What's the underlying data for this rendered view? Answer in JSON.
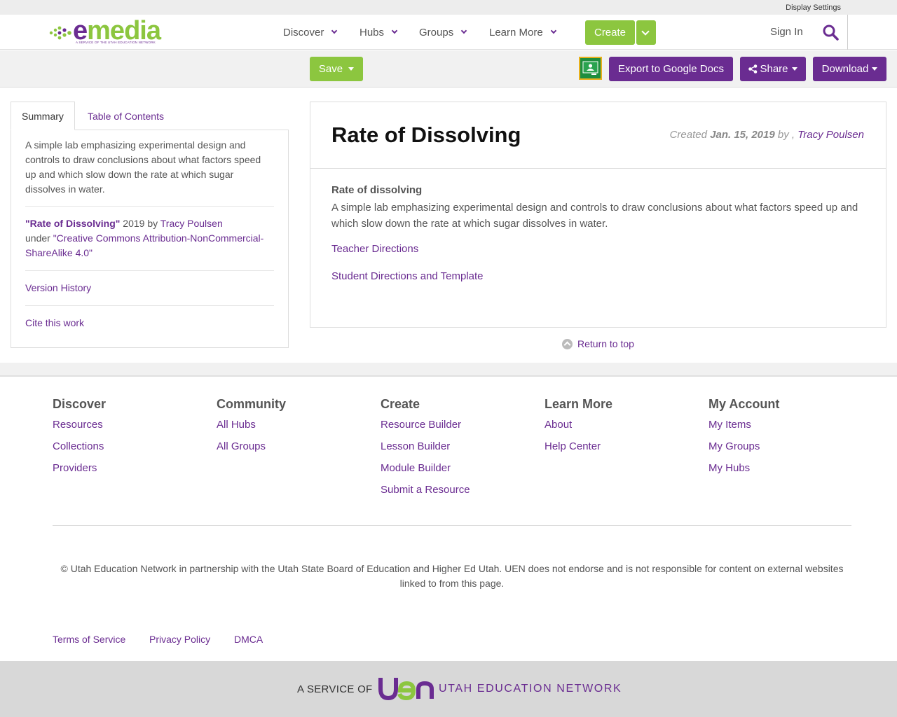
{
  "top_strip": {
    "display_settings": "Display Settings"
  },
  "logo": {
    "word_e": "e",
    "word_rest": "media",
    "tagline": "A SERVICE OF THE UTAH EDUCATION NETWORK"
  },
  "nav": {
    "items": [
      {
        "label": "Discover"
      },
      {
        "label": "Hubs"
      },
      {
        "label": "Groups"
      },
      {
        "label": "Learn More"
      }
    ],
    "create": "Create",
    "sign_in": "Sign In"
  },
  "toolbar": {
    "save": "Save",
    "export": "Export to Google Docs",
    "share": "Share",
    "download": "Download"
  },
  "left_tabs": {
    "summary": "Summary",
    "toc": "Table of Contents"
  },
  "summary": {
    "text": "A simple lab emphasizing experimental design and controls to draw conclusions about what factors speed up and which slow down the rate at which sugar dissolves in water.",
    "attrib_title": "\"Rate of Dissolving\"",
    "attrib_year_by": " 2019 by ",
    "attrib_author": "Tracy Poulsen",
    "attrib_under": "under ",
    "attrib_license": "\"Creative Commons Attribution-NonCommercial-ShareAlike 4.0\"",
    "version_history": "Version History",
    "cite": "Cite this work"
  },
  "resource": {
    "title": "Rate of Dissolving",
    "created_label": "Created ",
    "created_date": "Jan. 15, 2019",
    "by": " by , ",
    "author": "Tracy Poulsen",
    "heading": "Rate of dissolving",
    "description": "A simple lab emphasizing experimental design and controls to draw conclusions about what factors speed up and which slow down the rate at which sugar dissolves in water.",
    "link1": "Teacher Directions",
    "link2": "Student Directions and Template"
  },
  "return_to_top": "Return to top",
  "footer": {
    "columns": [
      {
        "title": "Discover",
        "links": [
          "Resources",
          "Collections",
          "Providers"
        ]
      },
      {
        "title": "Community",
        "links": [
          "All Hubs",
          "All Groups"
        ]
      },
      {
        "title": "Create",
        "links": [
          "Resource Builder",
          "Lesson Builder",
          "Module Builder",
          "Submit a Resource"
        ]
      },
      {
        "title": "Learn More",
        "links": [
          "About",
          "Help Center"
        ]
      },
      {
        "title": "My Account",
        "links": [
          "My Items",
          "My Groups",
          "My Hubs"
        ]
      }
    ],
    "copyright": "© Utah Education Network in partnership with the Utah State Board of Education and Higher Ed Utah. UEN does not endorse and is not responsible for content on external websites linked to from this page.",
    "legal": [
      "Terms of Service",
      "Privacy Policy",
      "DMCA"
    ],
    "service_of": "A SERVICE OF",
    "uen_text": "UTAH EDUCATION NETWORK"
  },
  "colors": {
    "brand_purple": "#6a2c91",
    "brand_green": "#8cc63f"
  }
}
